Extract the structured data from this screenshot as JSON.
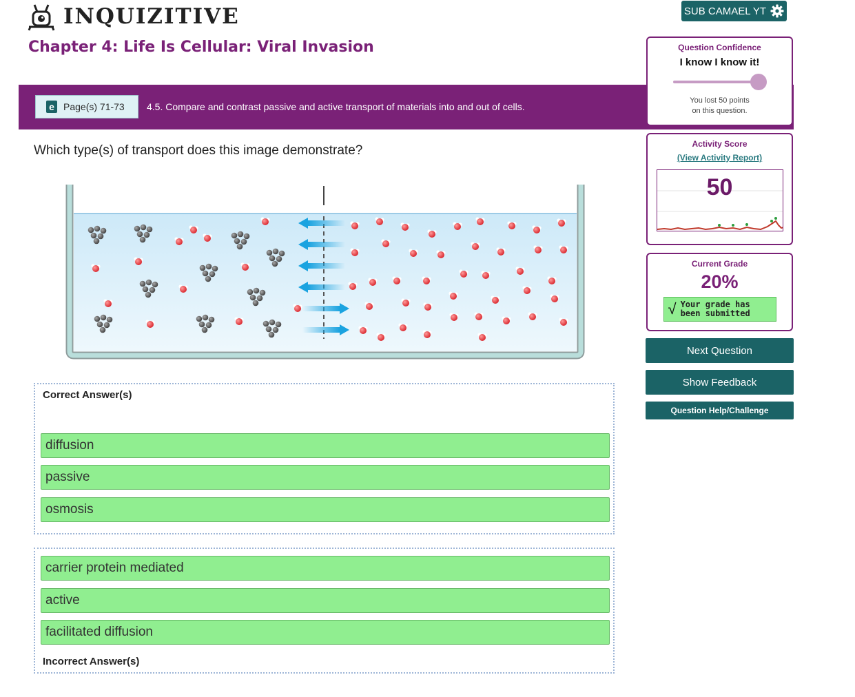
{
  "header": {
    "logo_text": "INQUIZITIVE",
    "user_button_label": "SUB CAMAEL YT"
  },
  "chapter": {
    "title": "Chapter 4: Life Is Cellular: Viral Invasion"
  },
  "objective": {
    "page_button_label": "Page(s) 71-73",
    "text": "4.5. Compare and contrast passive and active transport of materials into and out of cells."
  },
  "confidence": {
    "label": "Question Confidence",
    "value": "I know I know it!",
    "level": 1.0,
    "note_line1": "You lost 50 points",
    "note_line2": "on this question."
  },
  "activity_score": {
    "label": "Activity Score",
    "report_link": "(View Activity Report)",
    "value": "50"
  },
  "grade": {
    "label": "Current Grade",
    "value": "20%",
    "status_line1": "Your grade has",
    "status_line2": "been submitted"
  },
  "actions": {
    "next": "Next Question",
    "feedback": "Show Feedback",
    "help": "Question Help/Challenge"
  },
  "question": {
    "text": "Which type(s) of transport does this image demonstrate?"
  },
  "correct_zone": {
    "label": "Correct Answer(s)",
    "answers": [
      "diffusion",
      "passive",
      "osmosis"
    ]
  },
  "incorrect_zone": {
    "label": "Incorrect Answer(s)",
    "answers": [
      "carrier protein mediated",
      "active",
      "facilitated diffusion"
    ]
  },
  "colors": {
    "brand_purple": "#7a2177",
    "teal_button": "#1b6366",
    "answer_green": "#90ee90",
    "water_blue": "#d6eefb",
    "arrow_blue": "#1aa3e0"
  }
}
